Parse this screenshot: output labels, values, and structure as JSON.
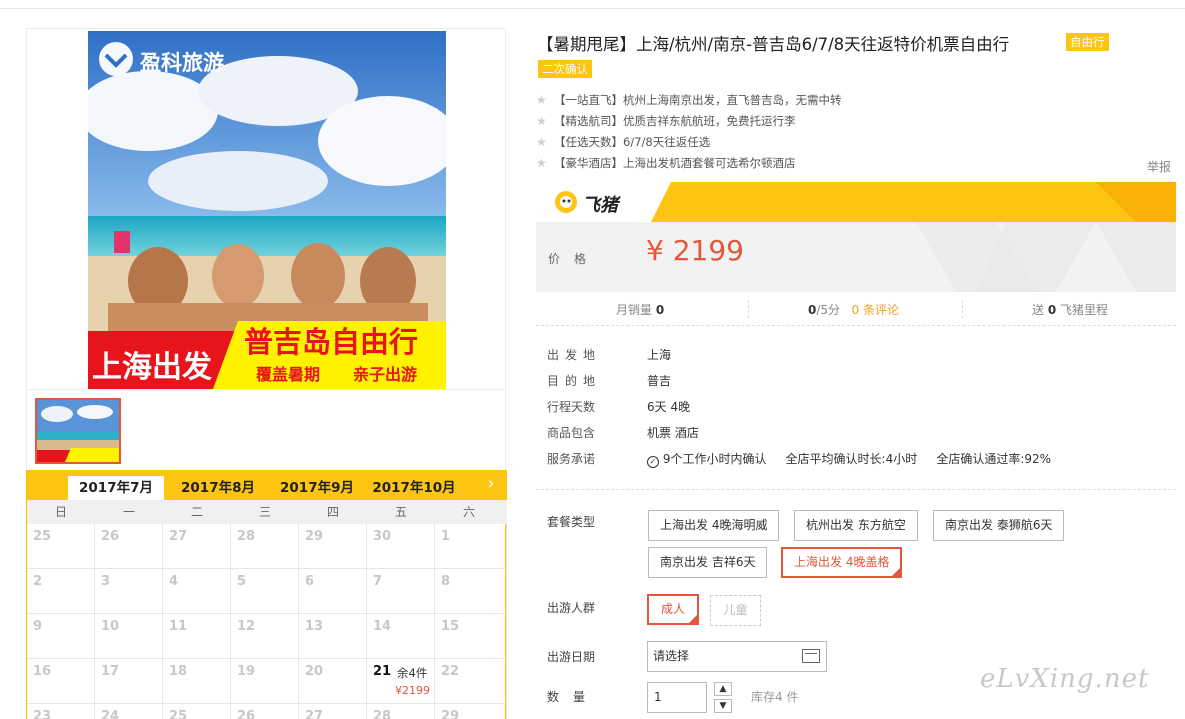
{
  "gallery": {
    "brand": "盈科旅游",
    "banner_main": "普吉岛自由行",
    "banner_left": "上海出发",
    "banner_sub1": "覆盖暑期",
    "banner_sub2": "亲子出游"
  },
  "calendar": {
    "months": [
      "2017年7月",
      "2017年8月",
      "2017年9月",
      "2017年10月"
    ],
    "active_month": 0,
    "next_icon": "›",
    "weekdays": [
      "日",
      "一",
      "二",
      "三",
      "四",
      "五",
      "六"
    ],
    "weeks": [
      [
        {
          "d": "25"
        },
        {
          "d": "26"
        },
        {
          "d": "27"
        },
        {
          "d": "28"
        },
        {
          "d": "29"
        },
        {
          "d": "30"
        },
        {
          "d": "1"
        }
      ],
      [
        {
          "d": "2"
        },
        {
          "d": "3"
        },
        {
          "d": "4"
        },
        {
          "d": "5"
        },
        {
          "d": "6"
        },
        {
          "d": "7"
        },
        {
          "d": "8"
        }
      ],
      [
        {
          "d": "9"
        },
        {
          "d": "10"
        },
        {
          "d": "11"
        },
        {
          "d": "12"
        },
        {
          "d": "13"
        },
        {
          "d": "14"
        },
        {
          "d": "15"
        }
      ],
      [
        {
          "d": "16"
        },
        {
          "d": "17"
        },
        {
          "d": "18"
        },
        {
          "d": "19"
        },
        {
          "d": "20"
        },
        {
          "d": "21",
          "stock": "余4件",
          "price": "¥2199",
          "avail": true
        },
        {
          "d": "22"
        }
      ],
      [
        {
          "d": "23"
        },
        {
          "d": "24"
        },
        {
          "d": "25"
        },
        {
          "d": "26"
        },
        {
          "d": "27"
        },
        {
          "d": "28"
        },
        {
          "d": "29"
        }
      ]
    ]
  },
  "product": {
    "title": "【暑期甩尾】上海/杭州/南京-普吉岛6/7/8天往返特价机票自由行",
    "tag_free": "自由行",
    "tag_confirm": "二次确认",
    "features": [
      "【一站直飞】杭州上海南京出发，直飞普吉岛，无需中转",
      "【精选航司】优质吉祥东航航班，免费托运行李",
      "【任选天数】6/7/8天往返任选",
      "【豪华酒店】上海出发机酒套餐可选希尔顿酒店"
    ],
    "report": "举报",
    "platform": "飞猪",
    "price_label": "价格",
    "price": "¥ 2199"
  },
  "stats": {
    "monthly_sales_label": "月销量",
    "monthly_sales": "0",
    "rating": "0",
    "rating_suffix": "/5分",
    "reviews_count": "0",
    "reviews_label": "条评论",
    "mileage_prefix": "送",
    "mileage": "0",
    "mileage_suffix": "飞猪里程"
  },
  "info": {
    "rows": [
      {
        "k": "出发地",
        "v": "上海"
      },
      {
        "k": "目的地",
        "v": "普吉"
      },
      {
        "k": "行程天数",
        "v": "6天 4晚"
      },
      {
        "k": "商品包含",
        "v": "机票  酒店"
      }
    ],
    "service_label": "服务承诺",
    "service_1": "9个工作小时内确认",
    "service_2": "全店平均确认时长:4小时",
    "service_3": "全店确认通过率:92%"
  },
  "options": {
    "package_label": "套餐类型",
    "packages": [
      "上海出发 4晚海明威",
      "杭州出发 东方航空",
      "南京出发 泰狮航6天",
      "南京出发 吉祥6天",
      "上海出发 4晚盖格"
    ],
    "people_label": "出游人群",
    "people": [
      "成人",
      "儿童"
    ],
    "date_label": "出游日期",
    "date_placeholder": "请选择",
    "qty_label": "数量",
    "qty_value": "1",
    "stock": "库存4 件"
  },
  "watermark": "eLvXing.net",
  "colors": {
    "accent": "#e4573d",
    "brand_yellow": "#fcc512"
  }
}
